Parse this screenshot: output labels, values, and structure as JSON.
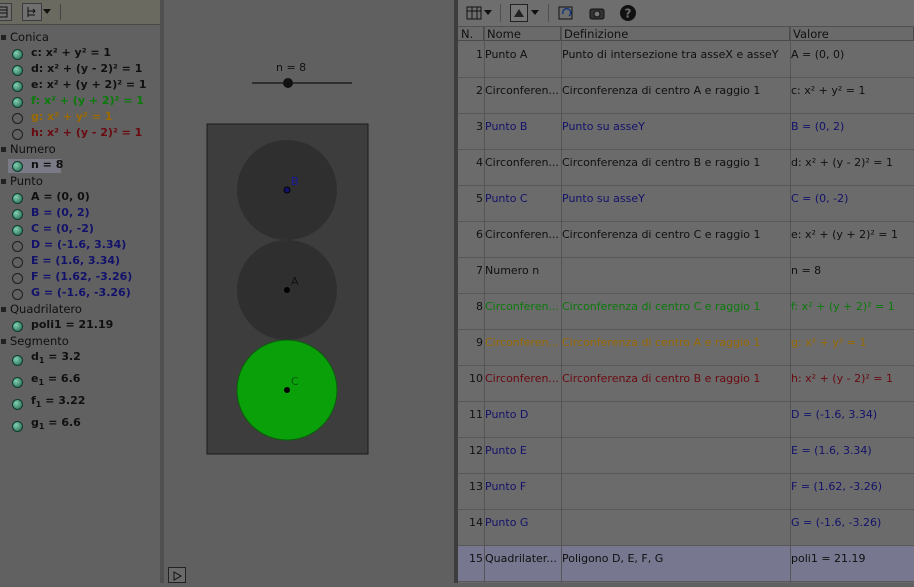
{
  "algebra": {
    "categories": {
      "conica": "Conica",
      "numero": "Numero",
      "punto": "Punto",
      "quadrilatero": "Quadrilatero",
      "segmento": "Segmento"
    },
    "conics": [
      {
        "text": "c: x² + y² = 1",
        "color": "#101010",
        "shown": true
      },
      {
        "text": "d: x² + (y - 2)² = 1",
        "color": "#101010",
        "shown": true
      },
      {
        "text": "e: x² + (y + 2)² = 1",
        "color": "#101010",
        "shown": true
      },
      {
        "text": "f: x² + (y + 2)² = 1",
        "color": "#0a7a0a",
        "shown": true
      },
      {
        "text": "g: x² + y² = 1",
        "color": "#9a6a00",
        "shown": false
      },
      {
        "text": "h: x² + (y - 2)² = 1",
        "color": "#6a0a10",
        "shown": false
      }
    ],
    "numbers": [
      {
        "text": "n = 8",
        "color": "#101010",
        "shown": true
      }
    ],
    "points": [
      {
        "text": "A = (0, 0)",
        "color": "#101010",
        "shown": true
      },
      {
        "text": "B = (0, 2)",
        "color": "#12126a",
        "shown": true
      },
      {
        "text": "C = (0, -2)",
        "color": "#12126a",
        "shown": true
      },
      {
        "text": "D = (-1.6, 3.34)",
        "color": "#12126a",
        "shown": false
      },
      {
        "text": "E = (1.6, 3.34)",
        "color": "#12126a",
        "shown": false
      },
      {
        "text": "F = (1.62, -3.26)",
        "color": "#12126a",
        "shown": false
      },
      {
        "text": "G = (-1.6, -3.26)",
        "color": "#12126a",
        "shown": false
      }
    ],
    "quads": [
      {
        "text": "poli1 = 21.19",
        "color": "#101010",
        "shown": true
      }
    ],
    "segments": [
      {
        "name": "d",
        "sub": "1",
        "value": " = 3.2"
      },
      {
        "name": "e",
        "sub": "1",
        "value": " = 6.6"
      },
      {
        "name": "f",
        "sub": "1",
        "value": " = 3.22"
      },
      {
        "name": "g",
        "sub": "1",
        "value": " = 6.6"
      }
    ]
  },
  "graphics": {
    "slider_label": "n = 8",
    "slider_value": 8,
    "point_labels": {
      "B": "B",
      "A": "A",
      "C": "C"
    },
    "colors": {
      "housing": "#3d3d3d",
      "lamp_off": "#2f2f2f",
      "lamp_on": "#0aa00a",
      "label_b": "#1818a0"
    }
  },
  "table": {
    "headers": {
      "num": "N.",
      "name": "Nome",
      "def": "Definizione",
      "value": "Valore"
    },
    "rows": [
      {
        "n": "1",
        "name": "Punto A",
        "def": "Punto di intersezione tra asseX e asseY",
        "value": "A = (0, 0)",
        "color": "#101010",
        "selected": false
      },
      {
        "n": "2",
        "name": "Circonferen...",
        "def": "Circonferenza di centro A e raggio 1",
        "value": "c: x² + y² = 1",
        "color": "#101010",
        "selected": false
      },
      {
        "n": "3",
        "name": "Punto B",
        "def": "Punto su asseY",
        "value": "B = (0, 2)",
        "color": "#12126a",
        "selected": false
      },
      {
        "n": "4",
        "name": "Circonferen...",
        "def": "Circonferenza di centro B e raggio 1",
        "value": "d: x² + (y - 2)² = 1",
        "color": "#101010",
        "selected": false
      },
      {
        "n": "5",
        "name": "Punto C",
        "def": "Punto su asseY",
        "value": "C = (0, -2)",
        "color": "#12126a",
        "selected": false
      },
      {
        "n": "6",
        "name": "Circonferen...",
        "def": "Circonferenza di centro C e raggio 1",
        "value": "e: x² + (y + 2)² = 1",
        "color": "#101010",
        "selected": false
      },
      {
        "n": "7",
        "name": "Numero n",
        "def": "",
        "value": "n = 8",
        "color": "#101010",
        "selected": false
      },
      {
        "n": "8",
        "name": "Circonferen...",
        "def": "Circonferenza di centro C e raggio 1",
        "value": "f: x² + (y + 2)² = 1",
        "color": "#0a7a0a",
        "selected": false
      },
      {
        "n": "9",
        "name": "Circonferen...",
        "def": "Circonferenza di centro A e raggio 1",
        "value": "g: x² + y² = 1",
        "color": "#9a6a00",
        "selected": false
      },
      {
        "n": "10",
        "name": "Circonferen...",
        "def": "Circonferenza di centro B e raggio 1",
        "value": "h: x² + (y - 2)² = 1",
        "color": "#6a0a10",
        "selected": false
      },
      {
        "n": "11",
        "name": "Punto D",
        "def": "",
        "value": "D = (-1.6, 3.34)",
        "color": "#12126a",
        "selected": false
      },
      {
        "n": "12",
        "name": "Punto E",
        "def": "",
        "value": "E = (1.6, 3.34)",
        "color": "#12126a",
        "selected": false
      },
      {
        "n": "13",
        "name": "Punto F",
        "def": "",
        "value": "F = (1.62, -3.26)",
        "color": "#12126a",
        "selected": false
      },
      {
        "n": "14",
        "name": "Punto G",
        "def": "",
        "value": "G = (-1.6, -3.26)",
        "color": "#12126a",
        "selected": false
      },
      {
        "n": "15",
        "name": "Quadrilater...",
        "def": "Poligono D, E, F, G",
        "value": "poli1 = 21.19",
        "color": "#101010",
        "selected": true
      }
    ]
  },
  "icons": [
    "algebra-view-icon",
    "sort-icon",
    "table-icon",
    "graphics-icon",
    "refresh-icon",
    "camera-icon",
    "help-icon",
    "play-icon"
  ]
}
